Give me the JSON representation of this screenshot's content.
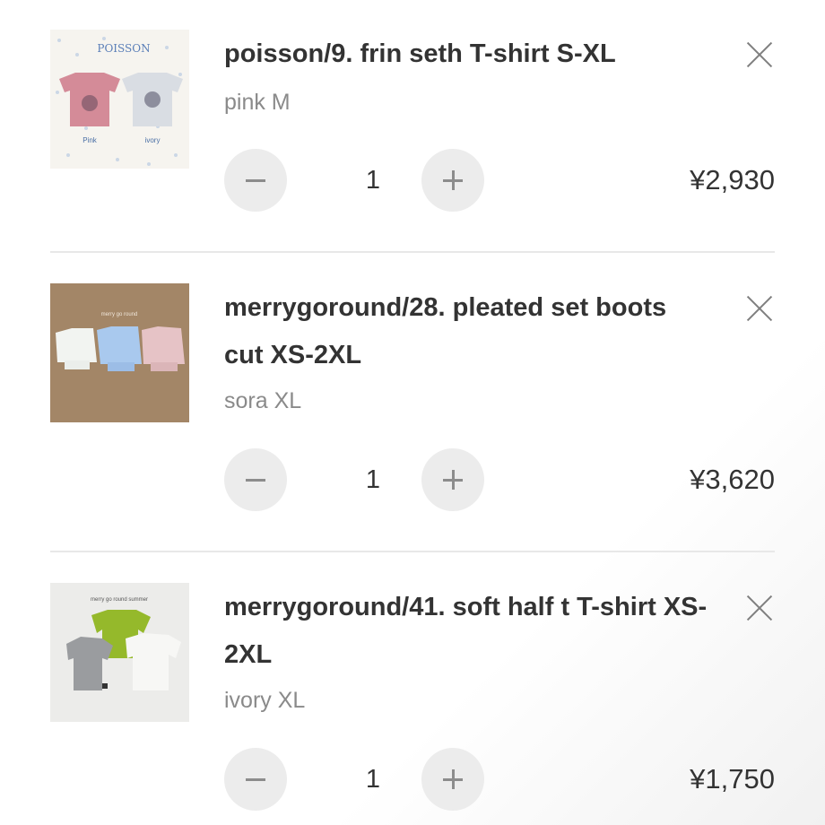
{
  "items": [
    {
      "title": "poisson/9. frin seth T-shirt S-XL",
      "variant": "pink M",
      "quantity": "1",
      "price": "¥2,930",
      "thumb_text": {
        "brand": "POISSON",
        "left": "Pink",
        "right": "ivory"
      }
    },
    {
      "title": "merrygoround/28. pleated set boots cut XS-2XL",
      "variant": "sora XL",
      "quantity": "1",
      "price": "¥3,620",
      "thumb_text": {
        "brand": "merry go round"
      }
    },
    {
      "title": "merrygoround/41. soft half t T-shirt XS-2XL",
      "variant": "ivory XL",
      "quantity": "1",
      "price": "¥1,750",
      "thumb_text": {
        "brand": "merry go round summer"
      }
    }
  ],
  "icons": {
    "remove": "close-icon",
    "decrease": "minus-icon",
    "increase": "plus-icon"
  },
  "colors": {
    "button_bg": "#ececec",
    "text": "#333333",
    "muted": "#8a8a8a"
  }
}
